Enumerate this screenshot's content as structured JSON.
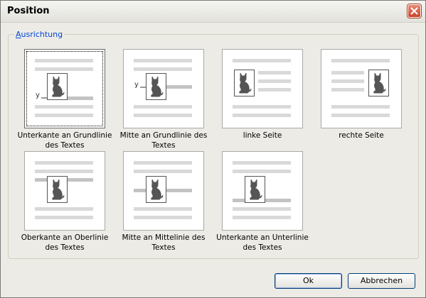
{
  "window": {
    "title": "Position"
  },
  "group": {
    "legend_first": "A",
    "legend_rest": "usrichtung"
  },
  "options": [
    {
      "label1": "Unterkante an Grundlinie",
      "label2": "des Textes",
      "selected": true,
      "ymark": "y"
    },
    {
      "label1": "Mitte an Grundlinie des",
      "label2": "Textes",
      "ymark": "y"
    },
    {
      "label1": "linke Seite",
      "label2": ""
    },
    {
      "label1": "rechte Seite",
      "label2": ""
    },
    {
      "label1": "Oberkante an Oberlinie",
      "label2": "des Textes"
    },
    {
      "label1": "Mitte an Mittelinie des",
      "label2": "Textes"
    },
    {
      "label1": "Unterkante an Unterlinie",
      "label2": "des Textes"
    }
  ],
  "buttons": {
    "ok": "Ok",
    "cancel": "Abbrechen"
  },
  "icons": {
    "close": "close-icon",
    "cat": "cat-icon"
  },
  "colors": {
    "accent": "#0046d5",
    "close": "#c8452a"
  }
}
